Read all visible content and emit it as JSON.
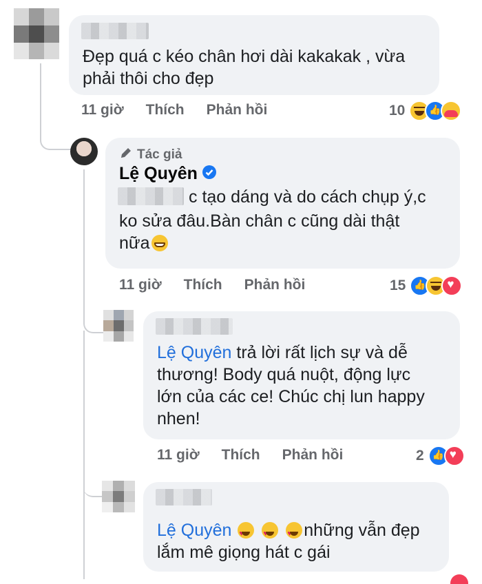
{
  "comments": [
    {
      "text": "Đẹp quá c kéo chân hơi dài kakakak , vừa phải thôi cho đẹp",
      "line1": "Đẹp quá c kéo chân hơi dài kakakak , vừa",
      "line2": "phải thôi cho đẹp",
      "time": "11 giờ",
      "like_label": "Thích",
      "reply_label": "Phản hồi",
      "reaction_count": "10",
      "reactions": [
        "haha-icon",
        "like-icon",
        "care-icon"
      ]
    },
    {
      "author_badge": "Tác giả",
      "author": "Lệ Quyên",
      "line1": "c tạo dáng và do cách chụp ý,c",
      "line2": "ko sửa đâu.Bàn chân c cũng dài thật",
      "line3": "nữa",
      "time": "11 giờ",
      "like_label": "Thích",
      "reply_label": "Phản hồi",
      "reaction_count": "15",
      "reactions": [
        "like-icon",
        "haha-icon",
        "love-icon"
      ]
    },
    {
      "mention": "Lệ Quyên",
      "line1_rest": " trả lời rất lịch sự và dễ",
      "line2": "thương! Body quá nuột, động lực",
      "line3": "lớn của các ce! Chúc chị lun happy",
      "line4": "nhen!",
      "time": "11 giờ",
      "like_label": "Thích",
      "reply_label": "Phản hồi",
      "reaction_count": "2",
      "reactions": [
        "like-icon",
        "love-icon"
      ]
    },
    {
      "mention": "Lệ Quyên",
      "line1_rest": "những vẫn đẹp",
      "line2": "lắm mê giọng hát c gái"
    }
  ],
  "colors": {
    "bubble": "#f0f2f5",
    "meta": "#65676b",
    "mention": "#216fdb",
    "verified": "#1877f2"
  }
}
